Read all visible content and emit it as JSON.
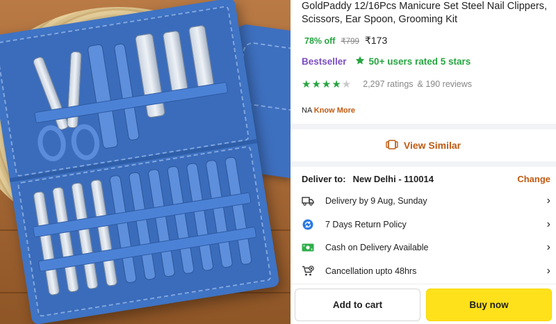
{
  "product": {
    "title": "GoldPaddy 12/16Pcs Manicure Set Steel Nail Clippers, Scissors, Ear Spoon, Grooming Kit",
    "image_alt": "blue-manicure-kit-photo"
  },
  "pricing": {
    "discount": "78% off",
    "mrp": "₹799",
    "price": "₹173"
  },
  "badges": {
    "bestseller": "Bestseller",
    "rated": "50+ users rated 5 stars"
  },
  "rating": {
    "stars": 4,
    "ratings": "2,297 ratings",
    "reviews": "& 190 reviews"
  },
  "seller": {
    "na": "NA",
    "know_more": "Know More"
  },
  "actions": {
    "view_similar": "View Similar",
    "add_to_cart": "Add to cart",
    "buy_now": "Buy now"
  },
  "delivery": {
    "label": "Deliver to:",
    "location": "New Delhi - 110014",
    "change": "Change",
    "items": [
      {
        "icon": "truck-icon",
        "text": "Delivery by 9 Aug, Sunday"
      },
      {
        "icon": "return-icon",
        "text": "7 Days Return Policy"
      },
      {
        "icon": "cash-icon",
        "text": "Cash on Delivery Available"
      },
      {
        "icon": "cancel-cart-icon",
        "text": "Cancellation upto 48hrs"
      }
    ]
  },
  "colors": {
    "accent": "#c05a12",
    "green": "#26a541",
    "bestseller": "#7b4cbf",
    "buy": "#ffe11b"
  }
}
